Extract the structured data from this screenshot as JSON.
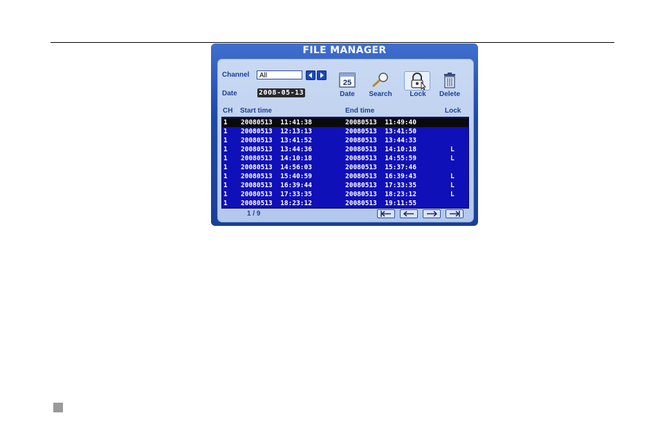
{
  "title": "FILE MANAGER",
  "channel": {
    "label": "Channel",
    "value": "All"
  },
  "date": {
    "label": "Date",
    "value": "2008-05-13"
  },
  "tools": [
    {
      "label": "Date",
      "icon": "calendar-icon",
      "day": "25"
    },
    {
      "label": "Search",
      "icon": "magnifier-icon"
    },
    {
      "label": "Lock",
      "icon": "padlock-icon"
    },
    {
      "label": "Delete",
      "icon": "trash-icon"
    }
  ],
  "columns": {
    "ch": "CH",
    "start": "Start time",
    "end": "End time",
    "lock": "Lock"
  },
  "rows": [
    {
      "ch": "1",
      "start": "20080513  11:41:38",
      "end": "20080513  11:49:40",
      "lock": ""
    },
    {
      "ch": "1",
      "start": "20080513  12:13:13",
      "end": "20080513  13:41:50",
      "lock": ""
    },
    {
      "ch": "1",
      "start": "20080513  13:41:52",
      "end": "20080513  13:44:33",
      "lock": ""
    },
    {
      "ch": "1",
      "start": "20080513  13:44:36",
      "end": "20080513  14:10:18",
      "lock": "L"
    },
    {
      "ch": "1",
      "start": "20080513  14:10:18",
      "end": "20080513  14:55:59",
      "lock": "L"
    },
    {
      "ch": "1",
      "start": "20080513  14:56:03",
      "end": "20080513  15:37:46",
      "lock": ""
    },
    {
      "ch": "1",
      "start": "20080513  15:40:59",
      "end": "20080513  16:39:43",
      "lock": "L"
    },
    {
      "ch": "1",
      "start": "20080513  16:39:44",
      "end": "20080513  17:33:35",
      "lock": "L"
    },
    {
      "ch": "1",
      "start": "20080513  17:33:35",
      "end": "20080513  18:23:12",
      "lock": "L"
    },
    {
      "ch": "1",
      "start": "20080513  18:23:12",
      "end": "20080513  19:11:55",
      "lock": ""
    }
  ],
  "page": "1 / 9"
}
